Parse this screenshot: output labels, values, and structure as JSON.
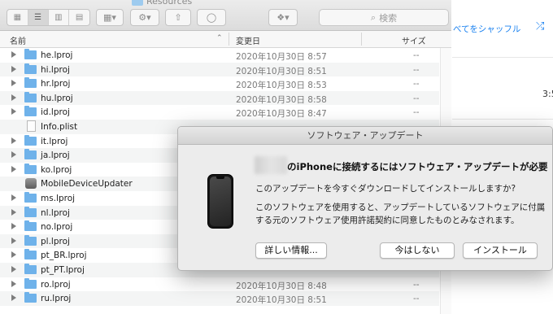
{
  "finder": {
    "path_title": "Resources",
    "search_placeholder": "検索",
    "columns": {
      "name": "名前",
      "date": "変更日",
      "size": "サイズ"
    },
    "rows": [
      {
        "name": "he.lproj",
        "date": "2020年10月30日 8:57",
        "size": "--",
        "kind": "folder"
      },
      {
        "name": "hi.lproj",
        "date": "2020年10月30日 8:51",
        "size": "--",
        "kind": "folder"
      },
      {
        "name": "hr.lproj",
        "date": "2020年10月30日 8:53",
        "size": "--",
        "kind": "folder"
      },
      {
        "name": "hu.lproj",
        "date": "2020年10月30日 8:58",
        "size": "--",
        "kind": "folder"
      },
      {
        "name": "id.lproj",
        "date": "2020年10月30日 8:47",
        "size": "--",
        "kind": "folder"
      },
      {
        "name": "Info.plist",
        "date": "",
        "size": "",
        "kind": "file"
      },
      {
        "name": "it.lproj",
        "date": "",
        "size": "",
        "kind": "folder"
      },
      {
        "name": "ja.lproj",
        "date": "",
        "size": "",
        "kind": "folder"
      },
      {
        "name": "ko.lproj",
        "date": "",
        "size": "",
        "kind": "folder"
      },
      {
        "name": "MobileDeviceUpdater",
        "date": "",
        "size": "",
        "kind": "app"
      },
      {
        "name": "ms.lproj",
        "date": "",
        "size": "",
        "kind": "folder"
      },
      {
        "name": "nl.lproj",
        "date": "",
        "size": "",
        "kind": "folder"
      },
      {
        "name": "no.lproj",
        "date": "",
        "size": "",
        "kind": "folder"
      },
      {
        "name": "pl.lproj",
        "date": "",
        "size": "",
        "kind": "folder"
      },
      {
        "name": "pt_BR.lproj",
        "date": "",
        "size": "",
        "kind": "folder"
      },
      {
        "name": "pt_PT.lproj",
        "date": "",
        "size": "",
        "kind": "folder"
      },
      {
        "name": "ro.lproj",
        "date": "2020年10月30日 8:48",
        "size": "--",
        "kind": "folder"
      },
      {
        "name": "ru.lproj",
        "date": "2020年10月30日 8:51",
        "size": "--",
        "kind": "folder"
      }
    ]
  },
  "background_app": {
    "shuffle_label": "べてをシャッフル",
    "time": "3:5"
  },
  "dialog": {
    "title": "ソフトウェア・アップデート",
    "heading": "のiPhoneに接続するにはソフトウェア・アップデートが必要",
    "text1": "このアップデートを今すぐダウンロードしてインストールしますか?",
    "text2": "このソフトウェアを使用すると、アップデートしているソフトウェアに付属する元のソフトウェア使用許諾契約に同意したものとみなされます。",
    "buttons": {
      "more_info": "詳しい情報...",
      "not_now": "今はしない",
      "install": "インストール"
    }
  }
}
